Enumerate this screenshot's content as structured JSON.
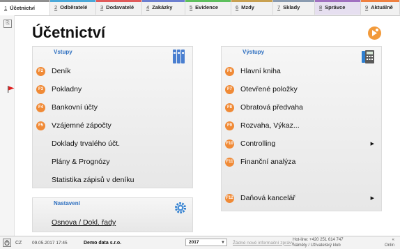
{
  "tabs": [
    {
      "num": "1",
      "label": "Účetnictví",
      "color": "#8f8f8f",
      "active": true
    },
    {
      "num": "2",
      "label": "Odběratelé",
      "color": "#4aa8d8"
    },
    {
      "num": "3",
      "label": "Dodavatelé",
      "color": "#e05a5a"
    },
    {
      "num": "4",
      "label": "Zakázky",
      "color": "#6c7fd0"
    },
    {
      "num": "5",
      "label": "Evidence",
      "color": "#5dbf5d"
    },
    {
      "num": "6",
      "label": "Mzdy",
      "color": "#c8a050"
    },
    {
      "num": "7",
      "label": "Sklady",
      "color": "#8a9bb0"
    },
    {
      "num": "8",
      "label": "Správce",
      "color": "#a070c0"
    },
    {
      "num": "9",
      "label": "Aktuálně",
      "color": "#ef8040"
    }
  ],
  "page_title": "Účetnictví",
  "vstupy": {
    "header": "Vstupy",
    "items": [
      {
        "key": "F2",
        "label": "Deník"
      },
      {
        "key": "F3",
        "label": "Pokladny"
      },
      {
        "key": "F4",
        "label": "Bankovní účty"
      },
      {
        "key": "F5",
        "label": "Vzájemné zápočty"
      },
      {
        "key": "",
        "label": "Doklady trvalého účt."
      },
      {
        "key": "",
        "label": "Plány & Prognózy"
      },
      {
        "key": "",
        "label": "Statistika zápisů v deníku"
      }
    ]
  },
  "nastaveni": {
    "header": "Nastavení",
    "item": "Osnova / Dokl. řady"
  },
  "vystupy": {
    "header": "Výstupy",
    "items": [
      {
        "key": "F6",
        "label": "Hlavní kniha"
      },
      {
        "key": "F7",
        "label": "Otevřené položky"
      },
      {
        "key": "F8",
        "label": "Obratová předvaha"
      },
      {
        "key": "F9",
        "label": "Rozvaha, Výkaz..."
      },
      {
        "key": "F10",
        "label": "Controlling",
        "arrow": "▶"
      },
      {
        "key": "F11",
        "label": "Finanční analýza"
      }
    ],
    "bottom_item": {
      "key": "F12",
      "label": "Daňová kancelář",
      "arrow": "▶"
    }
  },
  "statusbar": {
    "lang": "CZ",
    "datetime": "09.05.2017 17:45",
    "company": "Demo data s.r.o.",
    "year": "2017",
    "messages": "Žádné nové informační zprávy",
    "hotline": "Hot-line: +420 251 614 747",
    "club": "Náměty / Uživatelský klub",
    "right1": "«",
    "right2": "Onlin"
  },
  "colors": {
    "accent": "#f08a36",
    "header_blue": "#2c6ebf"
  }
}
